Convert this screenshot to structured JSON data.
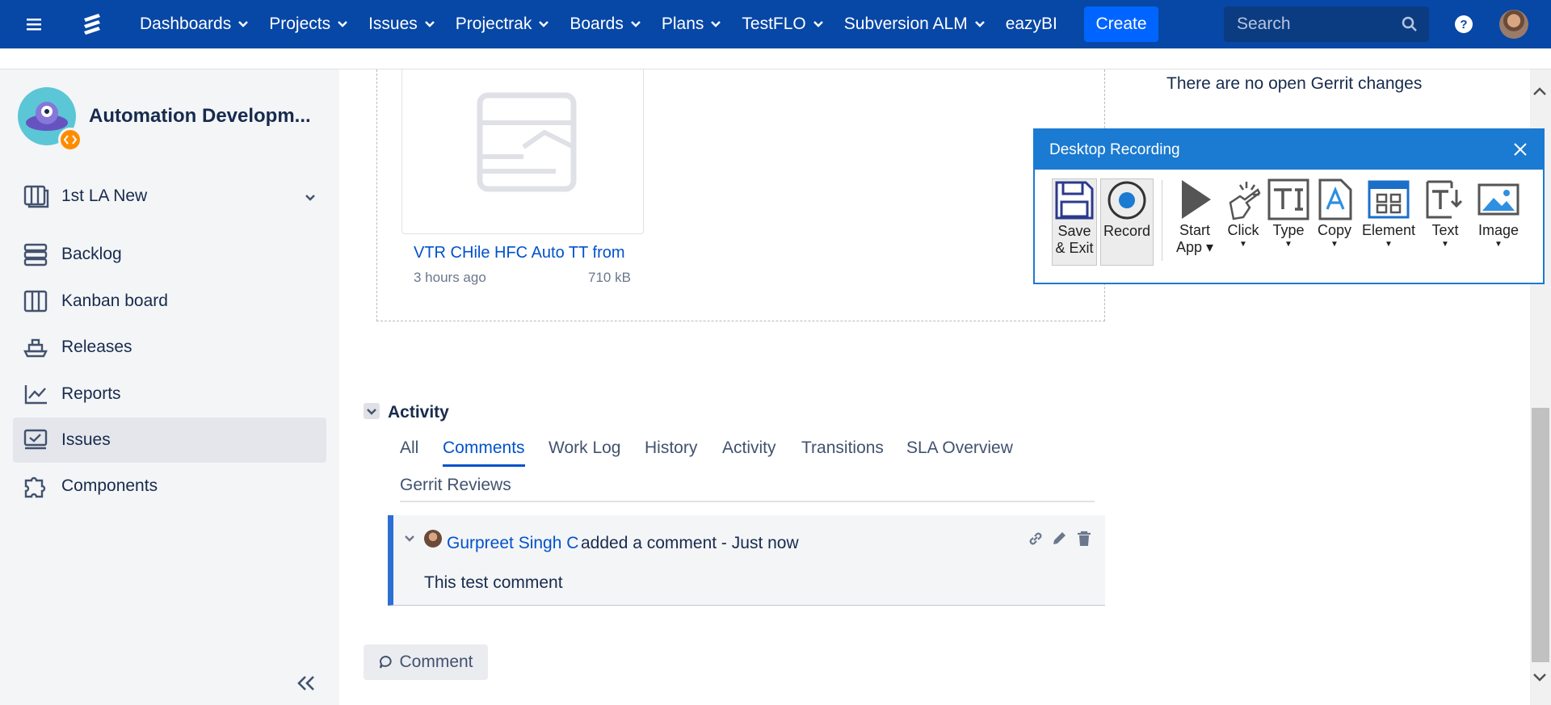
{
  "nav": {
    "items": [
      {
        "label": "Dashboards",
        "dropdown": true
      },
      {
        "label": "Projects",
        "dropdown": true
      },
      {
        "label": "Issues",
        "dropdown": true
      },
      {
        "label": "Projectrak",
        "dropdown": true
      },
      {
        "label": "Boards",
        "dropdown": true
      },
      {
        "label": "Plans",
        "dropdown": true
      },
      {
        "label": "TestFLO",
        "dropdown": true
      },
      {
        "label": "Subversion ALM",
        "dropdown": true
      },
      {
        "label": "eazyBI",
        "dropdown": false
      }
    ],
    "create_label": "Create",
    "search_placeholder": "Search",
    "colors": {
      "bar": "#0747a6",
      "create": "#0065ff"
    }
  },
  "sidebar": {
    "project_name": "Automation Developm...",
    "board_selector": "1st LA New",
    "items": [
      {
        "label": "Backlog",
        "icon": "backlog-icon"
      },
      {
        "label": "Kanban board",
        "icon": "kanban-icon"
      },
      {
        "label": "Releases",
        "icon": "ship-icon"
      },
      {
        "label": "Reports",
        "icon": "chart-icon"
      },
      {
        "label": "Issues",
        "icon": "issues-icon",
        "active": true
      },
      {
        "label": "Components",
        "icon": "puzzle-icon"
      }
    ]
  },
  "attachment": {
    "title": "VTR CHile HFC Auto TT from",
    "time": "3 hours ago",
    "size": "710 kB"
  },
  "gerrit": {
    "text": "There are no open Gerrit changes"
  },
  "activity": {
    "title": "Activity",
    "tabs": [
      "All",
      "Comments",
      "Work Log",
      "History",
      "Activity",
      "Transitions",
      "SLA Overview",
      "Gerrit Reviews"
    ],
    "active_tab": "Comments"
  },
  "comment": {
    "author": "Gurpreet Singh C",
    "meta": "added a comment - Just now",
    "body": "This test comment"
  },
  "comment_button": "Comment",
  "recorder": {
    "title": "Desktop Recording",
    "tools": [
      {
        "label": "Save\n& Exit",
        "line1": "Save",
        "line2": "& Exit",
        "icon": "floppy-icon"
      },
      {
        "label": "Record",
        "icon": "record-icon"
      },
      {
        "label": "Start App",
        "line1": "Start",
        "line2": "App",
        "icon": "play-icon"
      },
      {
        "label": "Click",
        "icon": "click-icon"
      },
      {
        "label": "Type",
        "icon": "type-icon"
      },
      {
        "label": "Copy",
        "icon": "copy-icon"
      },
      {
        "label": "Element",
        "icon": "element-icon"
      },
      {
        "label": "Text",
        "icon": "text-icon"
      },
      {
        "label": "Image",
        "icon": "image-icon"
      }
    ]
  }
}
